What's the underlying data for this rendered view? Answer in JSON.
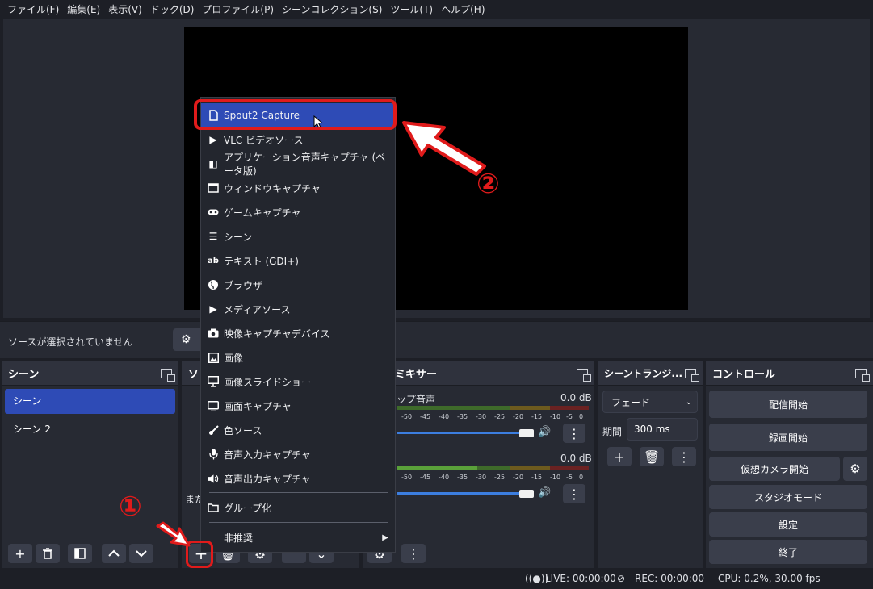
{
  "menubar": {
    "items": [
      "ファイル(F)",
      "編集(E)",
      "表示(V)",
      "ドック(D)",
      "プロファイル(P)",
      "シーンコレクション(S)",
      "ツール(T)",
      "ヘルプ(H)"
    ]
  },
  "source_bar": {
    "no_selection": "ソースが選択されていません"
  },
  "scenes": {
    "title": "シーン",
    "items": [
      "シーン",
      "シーン 2"
    ]
  },
  "sources": {
    "title": "ソ",
    "empty_hint": "また"
  },
  "mixer": {
    "title": "ミキサー",
    "channels": [
      {
        "name": "ップ音声",
        "level": "0.0 dB"
      },
      {
        "name": "",
        "level": "0.0 dB"
      }
    ],
    "scale": [
      "-50",
      "-45",
      "-40",
      "-35",
      "-30",
      "-25",
      "-20",
      "-15",
      "-10",
      "-5",
      "0"
    ]
  },
  "transitions": {
    "title": "シーントランジ...",
    "type": "フェード",
    "duration_label": "期間",
    "duration": "300 ms"
  },
  "controls": {
    "title": "コントロール",
    "start_stream": "配信開始",
    "start_record": "録画開始",
    "virtual_cam": "仮想カメラ開始",
    "studio_mode": "スタジオモード",
    "settings": "設定",
    "exit": "終了"
  },
  "context_menu": {
    "items": [
      {
        "label": "Spout2 Capture",
        "icon": "file-icon"
      },
      {
        "label": "VLC ビデオソース",
        "icon": "play-icon"
      },
      {
        "label": "アプリケーション音声キャプチャ (ベータ版)",
        "icon": "app-audio-icon"
      },
      {
        "label": "ウィンドウキャプチャ",
        "icon": "window-icon"
      },
      {
        "label": "ゲームキャプチャ",
        "icon": "gamepad-icon"
      },
      {
        "label": "シーン",
        "icon": "list-icon"
      },
      {
        "label": "テキスト (GDI+)",
        "icon": "text-icon"
      },
      {
        "label": "ブラウザ",
        "icon": "globe-icon"
      },
      {
        "label": "メディアソース",
        "icon": "play-icon"
      },
      {
        "label": "映像キャプチャデバイス",
        "icon": "camera-icon"
      },
      {
        "label": "画像",
        "icon": "image-icon"
      },
      {
        "label": "画像スライドショー",
        "icon": "slideshow-icon"
      },
      {
        "label": "画面キャプチャ",
        "icon": "monitor-icon"
      },
      {
        "label": "色ソース",
        "icon": "brush-icon"
      },
      {
        "label": "音声入力キャプチャ",
        "icon": "mic-icon"
      },
      {
        "label": "音声出力キャプチャ",
        "icon": "speaker-icon"
      }
    ],
    "group": "グループ化",
    "deprecated": "非推奨"
  },
  "annotations": {
    "step1": "①",
    "step2": "②"
  },
  "status_bar": {
    "live": "LIVE: 00:00:00",
    "rec": "REC: 00:00:00",
    "cpu": "CPU: 0.2%, 30.00 fps"
  },
  "colors": {
    "accent": "#2e4bb6",
    "annotation": "#e01b1b"
  }
}
